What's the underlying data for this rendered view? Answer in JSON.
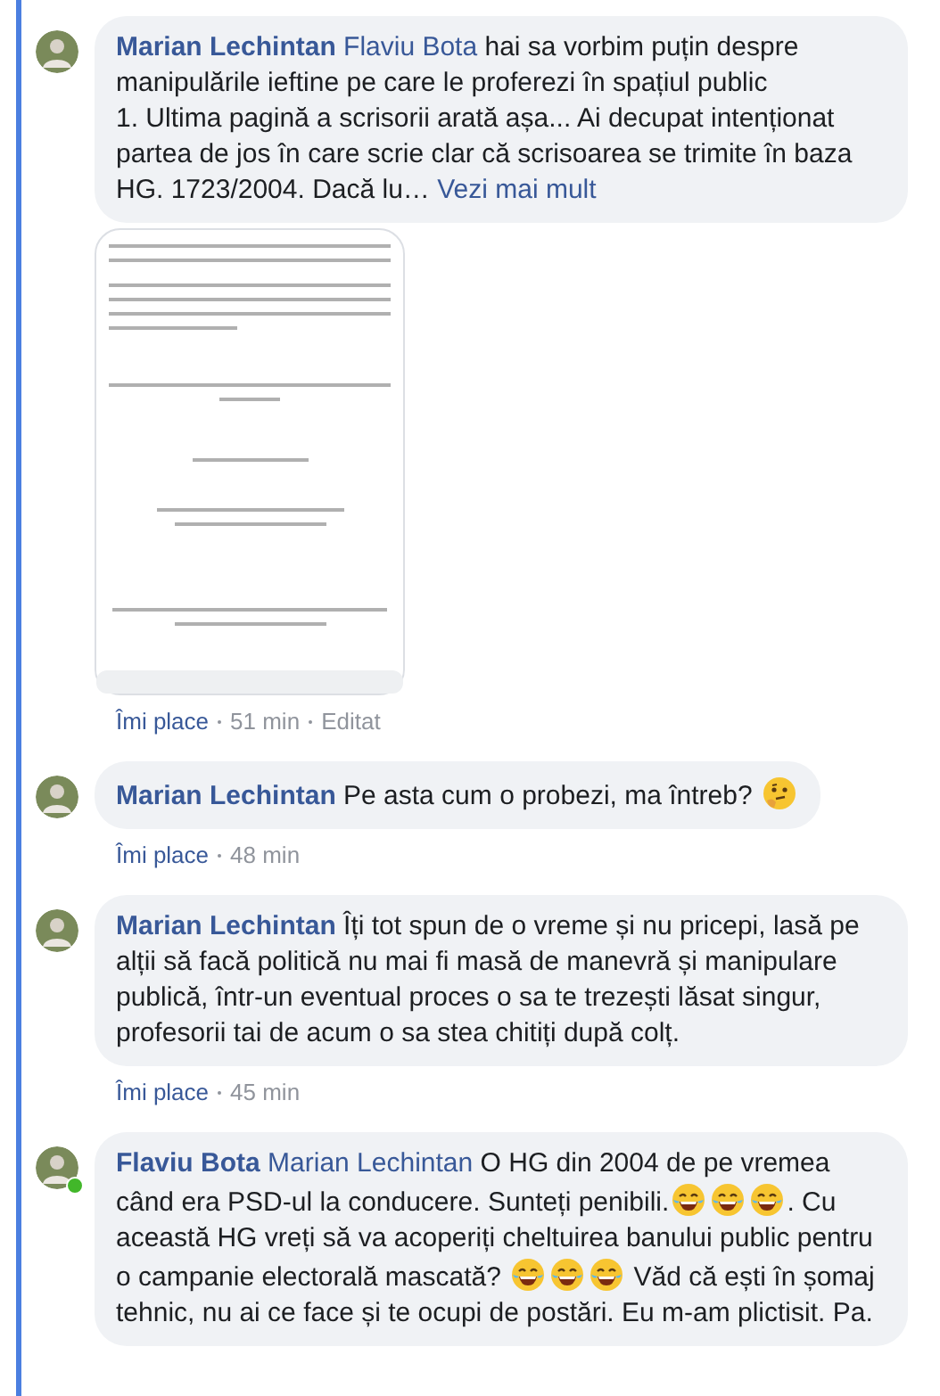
{
  "comments": [
    {
      "author": "Marian Lechintan",
      "online": false,
      "parts": [
        {
          "kind": "mention",
          "text": "Flaviu Bota"
        },
        {
          "kind": "text",
          "text": " hai sa vorbim puțin despre manipulările ieftine pe care le proferezi în spațiul public\n1. Ultima pagină a scrisorii arată așa... Ai decupat intenționat partea de jos în care scrie clar că scrisoarea se trimite în baza HG. 1723/2004. Dacă lu… "
        },
        {
          "kind": "link",
          "text": "Vezi mai mult"
        }
      ],
      "attachment": {
        "kind": "document-image"
      },
      "actions": {
        "like": "Îmi place",
        "time": "51 min",
        "edited": "Editat"
      }
    },
    {
      "author": "Marian Lechintan",
      "online": false,
      "parts": [
        {
          "kind": "text",
          "text": " Pe asta cum o probezi, ma întreb? "
        },
        {
          "kind": "thinking-emoji"
        }
      ],
      "actions": {
        "like": "Îmi place",
        "time": "48 min"
      }
    },
    {
      "author": "Marian Lechintan",
      "online": false,
      "parts": [
        {
          "kind": "text",
          "text": " Îți tot spun de o vreme și nu pricepi, lasă pe alții să facă politică nu mai fi masă de manevră și manipulare publică, într-un eventual proces o sa te trezești lăsat singur, profesorii tai de acum o sa stea chitiți după colț."
        }
      ],
      "actions": {
        "like": "Îmi place",
        "time": "45 min"
      }
    },
    {
      "author": "Flaviu Bota",
      "online": true,
      "parts": [
        {
          "kind": "mention",
          "text": "Marian Lechintan"
        },
        {
          "kind": "text",
          "text": " O HG din 2004 de pe vremea când era PSD-ul la conducere. Sunteți penibili."
        },
        {
          "kind": "laughing-emoji"
        },
        {
          "kind": "laughing-emoji"
        },
        {
          "kind": "laughing-emoji"
        },
        {
          "kind": "text",
          "text": ". Cu această HG vreți să va acoperiți cheltuirea banului public pentru o campanie electorală mascată? "
        },
        {
          "kind": "laughing-emoji"
        },
        {
          "kind": "laughing-emoji"
        },
        {
          "kind": "laughing-emoji"
        },
        {
          "kind": "text",
          "text": " Văd că ești în șomaj tehnic, nu ai ce face și te ocupi de postări. Eu m-am plictisit. Pa."
        }
      ]
    }
  ]
}
